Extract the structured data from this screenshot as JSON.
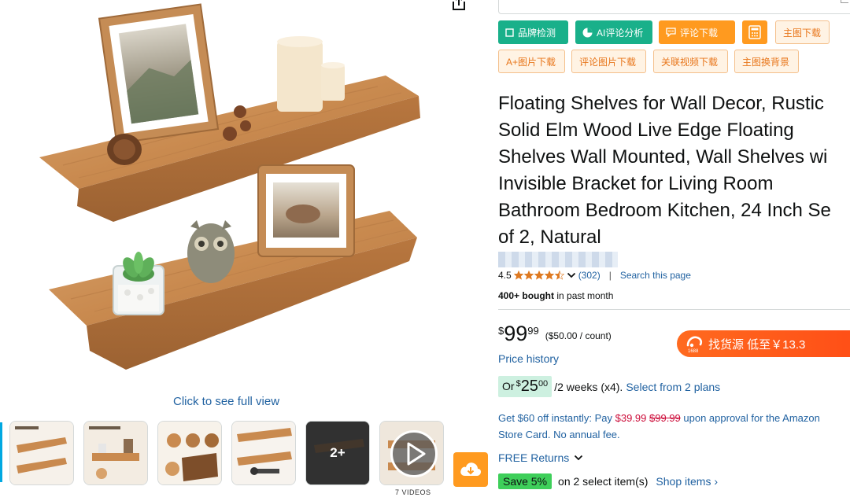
{
  "toolbar": {
    "row1": [
      {
        "label": "品牌检测",
        "icon": "checkbox-icon",
        "style": "green"
      },
      {
        "label": "AI评论分析",
        "icon": "pie-chart-icon",
        "style": "green"
      },
      {
        "label": "评论下载",
        "icon": "comment-icon",
        "style": "orange"
      },
      {
        "label": "",
        "icon": "calculator-icon",
        "style": "orange"
      },
      {
        "label": "主图下载",
        "icon": "",
        "style": "outline"
      }
    ],
    "row2": [
      {
        "label": "A+图片下载"
      },
      {
        "label": "评论图片下载"
      },
      {
        "label": "关联视频下载"
      },
      {
        "label": "主图换背景"
      }
    ]
  },
  "media": {
    "full_view_label": "Click to see full view",
    "more_label": "2+",
    "videos_label": "7 VIDEOS"
  },
  "product": {
    "title_lines": [
      "Floating Shelves for Wall Decor, Rustic",
      "Solid Elm Wood Live Edge Floating",
      "Shelves Wall Mounted, Wall Shelves wi",
      "Invisible Bracket for Living Room",
      "Bathroom Bedroom Kitchen, 24 Inch Se",
      "of 2, Natural"
    ],
    "rating": "4.5",
    "rating_fraction": 0.9,
    "review_count": "(302)",
    "search_page_label": "Search this page",
    "bought_bold": "400+ bought",
    "bought_rest": " in past month"
  },
  "price": {
    "currency": "$",
    "whole": "99",
    "fraction": "99",
    "unit_price": "($50.00 / count)",
    "history_label": "Price history",
    "plan_prefix": "Or ",
    "plan_whole": "25",
    "plan_fraction": "00",
    "plan_text": "/2 weeks (x4).",
    "plan_link": "Select from 2 plans"
  },
  "sourcing": {
    "label": "找货源 低至￥13.3",
    "logo_text": "1688"
  },
  "card_offer": {
    "part1": "Get $60 off instantly: Pay ",
    "new_price": "$39.99",
    "old_price": "$99.99",
    "part2": " upon approval for the Amazon",
    "line2": "Store Card. No annual fee."
  },
  "returns": {
    "label": "FREE Returns"
  },
  "save": {
    "badge": "Save 5%",
    "text": "on 2 select item(s)",
    "link": "Shop items ›"
  },
  "colors": {
    "link": "#2162a1",
    "tool_green": "#19b08a",
    "tool_orange": "#ff9a1f",
    "price_red": "#cc0c39",
    "star": "#de7921",
    "save_green": "#3ecf5a"
  }
}
